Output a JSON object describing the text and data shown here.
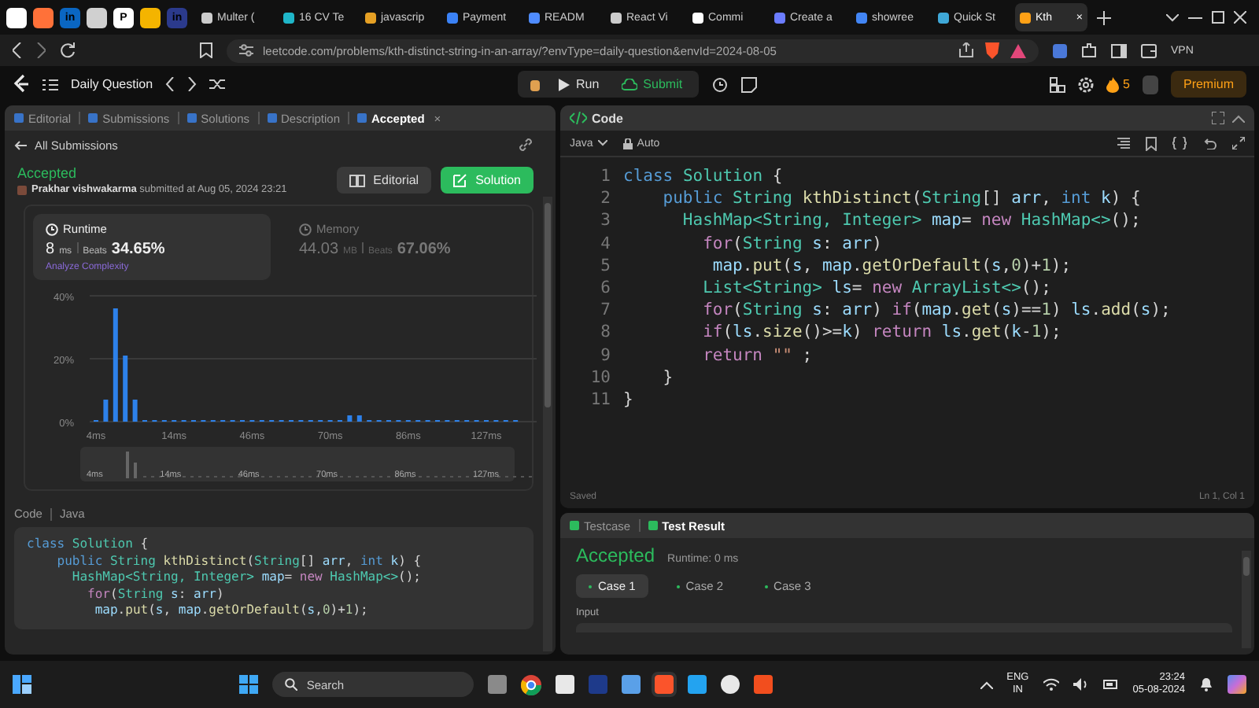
{
  "browser": {
    "pinned": [
      {
        "color": "#ffffff"
      },
      {
        "color": "#ff7139"
      },
      {
        "glyph": "in",
        "color": "#0a66c2"
      },
      {
        "color": "#d0d0d0"
      },
      {
        "glyph": "P",
        "color": "#ffffff"
      },
      {
        "color": "#f4b400"
      },
      {
        "glyph": "in",
        "color": "#2b3a8c"
      }
    ],
    "tabs": [
      {
        "title": "Multer (",
        "selected": false,
        "color": "#cccccc"
      },
      {
        "title": "16 CV Te",
        "selected": false,
        "color": "#1fb6c9"
      },
      {
        "title": "javascrip",
        "selected": false,
        "color": "#e5a024"
      },
      {
        "title": "Payment",
        "selected": false,
        "color": "#3b82f6"
      },
      {
        "title": "READM",
        "selected": false,
        "color": "#4f8cff"
      },
      {
        "title": "React Vi",
        "selected": false,
        "color": "#cccccc"
      },
      {
        "title": "Commi",
        "selected": false,
        "color": "#ffffff"
      },
      {
        "title": "Create a",
        "selected": false,
        "color": "#6b7cff"
      },
      {
        "title": "showree",
        "selected": false,
        "color": "#4285f4"
      },
      {
        "title": "Quick St",
        "selected": false,
        "color": "#3fa8d8"
      },
      {
        "title": "Kth",
        "selected": true,
        "color": "#ffa116",
        "close": "×"
      }
    ],
    "url": "leetcode.com/problems/kth-distinct-string-in-an-array/?envType=daily-question&envId=2024-08-05",
    "vpn": "VPN"
  },
  "nav": {
    "title": "Daily Question",
    "run": "Run",
    "submit": "Submit",
    "streak": "5",
    "premium": "Premium"
  },
  "left": {
    "tabs": [
      {
        "label": "Editorial",
        "selected": false
      },
      {
        "label": "Submissions",
        "selected": false
      },
      {
        "label": "Solutions",
        "selected": false
      },
      {
        "label": "Description",
        "selected": false
      },
      {
        "label": "Accepted",
        "selected": true,
        "close": "×"
      }
    ],
    "back": "All Submissions",
    "status": "Accepted",
    "author": "Prakhar vishwakarma",
    "submitted": "submitted at Aug 05, 2024 23:21",
    "editorial_button": "Editorial",
    "solution_button": "Solution",
    "stats": [
      {
        "label": "Runtime",
        "value": "8",
        "unit": "ms",
        "beats_label": "Beats",
        "beats": "34.65%",
        "selected": true,
        "link": "Analyze Complexity"
      },
      {
        "label": "Memory",
        "value": "44.03",
        "unit": "MB",
        "beats_label": "Beats",
        "beats": "67.06%",
        "selected": false
      }
    ],
    "chart_data": {
      "type": "bar",
      "yticks": [
        {
          "value": 0,
          "label": "0%"
        },
        {
          "value": 20,
          "label": "20%"
        },
        {
          "value": 40,
          "label": "40%"
        }
      ],
      "ylim": [
        0,
        40
      ],
      "categories": [
        "4ms",
        null,
        null,
        null,
        null,
        null,
        null,
        null,
        "14ms",
        null,
        null,
        null,
        null,
        null,
        null,
        null,
        "46ms",
        null,
        null,
        null,
        null,
        null,
        null,
        null,
        "70ms",
        null,
        null,
        null,
        null,
        null,
        null,
        null,
        "86ms",
        null,
        null,
        null,
        null,
        null,
        null,
        null,
        "127ms",
        null,
        null,
        null
      ],
      "values": [
        0.5,
        7,
        36,
        21,
        7,
        0.5,
        0.5,
        0.5,
        0.5,
        0.5,
        0.5,
        0.5,
        0.5,
        0.5,
        0.5,
        0.5,
        0.5,
        0.5,
        0.5,
        0.5,
        0.5,
        0.5,
        0.5,
        0.5,
        0.5,
        0.5,
        2,
        2,
        0.5,
        0.5,
        0.5,
        0.5,
        0.5,
        0.5,
        0.5,
        0.5,
        0.5,
        0.5,
        0.5,
        0.5,
        0.5,
        0.5,
        0.5,
        0.5
      ]
    },
    "brush_labels": [
      "4ms",
      "14ms",
      "46ms",
      "70ms",
      "86ms",
      "127ms"
    ],
    "code_label": "Code",
    "code_lang": "Java",
    "code": [
      [
        {
          "kind": "kw",
          "text": "class "
        },
        {
          "kind": "type",
          "text": "Solution"
        },
        {
          "kind": "plain",
          "text": " {"
        }
      ],
      [
        {
          "kind": "kw",
          "text": "    public "
        },
        {
          "kind": "type",
          "text": "String "
        },
        {
          "kind": "fn",
          "text": "kthDistinct"
        },
        {
          "kind": "plain",
          "text": "("
        },
        {
          "kind": "type",
          "text": "String"
        },
        {
          "kind": "plain",
          "text": "[] "
        },
        {
          "kind": "var",
          "text": "arr"
        },
        {
          "kind": "plain",
          "text": ", "
        },
        {
          "kind": "kw",
          "text": "int "
        },
        {
          "kind": "var",
          "text": "k"
        },
        {
          "kind": "plain",
          "text": ") {"
        }
      ],
      [
        {
          "kind": "type",
          "text": "      HashMap<String, Integer> "
        },
        {
          "kind": "var",
          "text": "map"
        },
        {
          "kind": "plain",
          "text": "= "
        },
        {
          "kind": "ctrl",
          "text": "new "
        },
        {
          "kind": "type",
          "text": "HashMap<>"
        },
        {
          "kind": "plain",
          "text": "();"
        }
      ],
      [
        {
          "kind": "ctrl",
          "text": "        for"
        },
        {
          "kind": "plain",
          "text": "("
        },
        {
          "kind": "type",
          "text": "String "
        },
        {
          "kind": "var",
          "text": "s"
        },
        {
          "kind": "plain",
          "text": ": "
        },
        {
          "kind": "var",
          "text": "arr"
        },
        {
          "kind": "plain",
          "text": ")"
        }
      ],
      [
        {
          "kind": "var",
          "text": "         map"
        },
        {
          "kind": "plain",
          "text": "."
        },
        {
          "kind": "fn",
          "text": "put"
        },
        {
          "kind": "plain",
          "text": "("
        },
        {
          "kind": "var",
          "text": "s"
        },
        {
          "kind": "plain",
          "text": ", "
        },
        {
          "kind": "var",
          "text": "map"
        },
        {
          "kind": "plain",
          "text": "."
        },
        {
          "kind": "fn",
          "text": "getOrDefault"
        },
        {
          "kind": "plain",
          "text": "("
        },
        {
          "kind": "var",
          "text": "s"
        },
        {
          "kind": "plain",
          "text": ","
        },
        {
          "kind": "num",
          "text": "0"
        },
        {
          "kind": "plain",
          "text": ")+"
        },
        {
          "kind": "num",
          "text": "1"
        },
        {
          "kind": "plain",
          "text": ");"
        }
      ]
    ]
  },
  "editor": {
    "title": "Code",
    "language": "Java",
    "mode": "Auto",
    "saved": "Saved",
    "position": "Ln 1, Col 1",
    "lines": [
      {
        "number": "1",
        "tokens": [
          {
            "kind": "kw",
            "text": "class "
          },
          {
            "kind": "type",
            "text": "Solution"
          },
          {
            "kind": "plain",
            "text": " {"
          }
        ]
      },
      {
        "number": "2",
        "tokens": [
          {
            "kind": "kw",
            "text": "    public "
          },
          {
            "kind": "type",
            "text": "String "
          },
          {
            "kind": "fn",
            "text": "kthDistinct"
          },
          {
            "kind": "plain",
            "text": "("
          },
          {
            "kind": "type",
            "text": "String"
          },
          {
            "kind": "plain",
            "text": "[] "
          },
          {
            "kind": "var",
            "text": "arr"
          },
          {
            "kind": "plain",
            "text": ", "
          },
          {
            "kind": "kw",
            "text": "int "
          },
          {
            "kind": "var",
            "text": "k"
          },
          {
            "kind": "plain",
            "text": ") {"
          }
        ]
      },
      {
        "number": "3",
        "tokens": [
          {
            "kind": "type",
            "text": "      HashMap<String, Integer> "
          },
          {
            "kind": "var",
            "text": "map"
          },
          {
            "kind": "plain",
            "text": "= "
          },
          {
            "kind": "ctrl",
            "text": "new "
          },
          {
            "kind": "type",
            "text": "HashMap<>"
          },
          {
            "kind": "plain",
            "text": "();"
          }
        ]
      },
      {
        "number": "4",
        "tokens": [
          {
            "kind": "ctrl",
            "text": "        for"
          },
          {
            "kind": "plain",
            "text": "("
          },
          {
            "kind": "type",
            "text": "String "
          },
          {
            "kind": "var",
            "text": "s"
          },
          {
            "kind": "plain",
            "text": ": "
          },
          {
            "kind": "var",
            "text": "arr"
          },
          {
            "kind": "plain",
            "text": ")"
          }
        ]
      },
      {
        "number": "5",
        "tokens": [
          {
            "kind": "var",
            "text": "         map"
          },
          {
            "kind": "plain",
            "text": "."
          },
          {
            "kind": "fn",
            "text": "put"
          },
          {
            "kind": "plain",
            "text": "("
          },
          {
            "kind": "var",
            "text": "s"
          },
          {
            "kind": "plain",
            "text": ", "
          },
          {
            "kind": "var",
            "text": "map"
          },
          {
            "kind": "plain",
            "text": "."
          },
          {
            "kind": "fn",
            "text": "getOrDefault"
          },
          {
            "kind": "plain",
            "text": "("
          },
          {
            "kind": "var",
            "text": "s"
          },
          {
            "kind": "plain",
            "text": ","
          },
          {
            "kind": "num",
            "text": "0"
          },
          {
            "kind": "plain",
            "text": ")+"
          },
          {
            "kind": "num",
            "text": "1"
          },
          {
            "kind": "plain",
            "text": ");"
          }
        ]
      },
      {
        "number": "6",
        "tokens": [
          {
            "kind": "type",
            "text": "        List<String> "
          },
          {
            "kind": "var",
            "text": "ls"
          },
          {
            "kind": "plain",
            "text": "= "
          },
          {
            "kind": "ctrl",
            "text": "new "
          },
          {
            "kind": "type",
            "text": "ArrayList<>"
          },
          {
            "kind": "plain",
            "text": "();"
          }
        ]
      },
      {
        "number": "7",
        "tokens": [
          {
            "kind": "ctrl",
            "text": "        for"
          },
          {
            "kind": "plain",
            "text": "("
          },
          {
            "kind": "type",
            "text": "String "
          },
          {
            "kind": "var",
            "text": "s"
          },
          {
            "kind": "plain",
            "text": ": "
          },
          {
            "kind": "var",
            "text": "arr"
          },
          {
            "kind": "plain",
            "text": ") "
          },
          {
            "kind": "ctrl",
            "text": "if"
          },
          {
            "kind": "plain",
            "text": "("
          },
          {
            "kind": "var",
            "text": "map"
          },
          {
            "kind": "plain",
            "text": "."
          },
          {
            "kind": "fn",
            "text": "get"
          },
          {
            "kind": "plain",
            "text": "("
          },
          {
            "kind": "var",
            "text": "s"
          },
          {
            "kind": "plain",
            "text": ")=="
          },
          {
            "kind": "num",
            "text": "1"
          },
          {
            "kind": "plain",
            "text": ") "
          },
          {
            "kind": "var",
            "text": "ls"
          },
          {
            "kind": "plain",
            "text": "."
          },
          {
            "kind": "fn",
            "text": "add"
          },
          {
            "kind": "plain",
            "text": "("
          },
          {
            "kind": "var",
            "text": "s"
          },
          {
            "kind": "plain",
            "text": ");"
          }
        ]
      },
      {
        "number": "8",
        "tokens": [
          {
            "kind": "ctrl",
            "text": "        if"
          },
          {
            "kind": "plain",
            "text": "("
          },
          {
            "kind": "var",
            "text": "ls"
          },
          {
            "kind": "plain",
            "text": "."
          },
          {
            "kind": "fn",
            "text": "size"
          },
          {
            "kind": "plain",
            "text": "()>="
          },
          {
            "kind": "var",
            "text": "k"
          },
          {
            "kind": "plain",
            "text": ") "
          },
          {
            "kind": "ctrl",
            "text": "return "
          },
          {
            "kind": "var",
            "text": "ls"
          },
          {
            "kind": "plain",
            "text": "."
          },
          {
            "kind": "fn",
            "text": "get"
          },
          {
            "kind": "plain",
            "text": "("
          },
          {
            "kind": "var",
            "text": "k"
          },
          {
            "kind": "plain",
            "text": "-"
          },
          {
            "kind": "num",
            "text": "1"
          },
          {
            "kind": "plain",
            "text": ");"
          }
        ]
      },
      {
        "number": "9",
        "tokens": [
          {
            "kind": "ctrl",
            "text": "        return "
          },
          {
            "kind": "str",
            "text": "\"\""
          },
          {
            "kind": "plain",
            "text": " ;"
          }
        ]
      },
      {
        "number": "10",
        "tokens": [
          {
            "kind": "plain",
            "text": "    }"
          }
        ]
      },
      {
        "number": "11",
        "tokens": [
          {
            "kind": "plain",
            "text": "}"
          }
        ]
      }
    ]
  },
  "result": {
    "tabs": [
      {
        "label": "Testcase",
        "selected": false
      },
      {
        "label": "Test Result",
        "selected": true
      }
    ],
    "status": "Accepted",
    "runtime": "Runtime: 0 ms",
    "cases": [
      {
        "label": "Case 1",
        "selected": true
      },
      {
        "label": "Case 2",
        "selected": false
      },
      {
        "label": "Case 3",
        "selected": false
      }
    ],
    "input_label": "Input"
  },
  "taskbar": {
    "search": "Search",
    "lang": "ENG",
    "region": "IN",
    "time": "23:24",
    "date": "05-08-2024"
  }
}
